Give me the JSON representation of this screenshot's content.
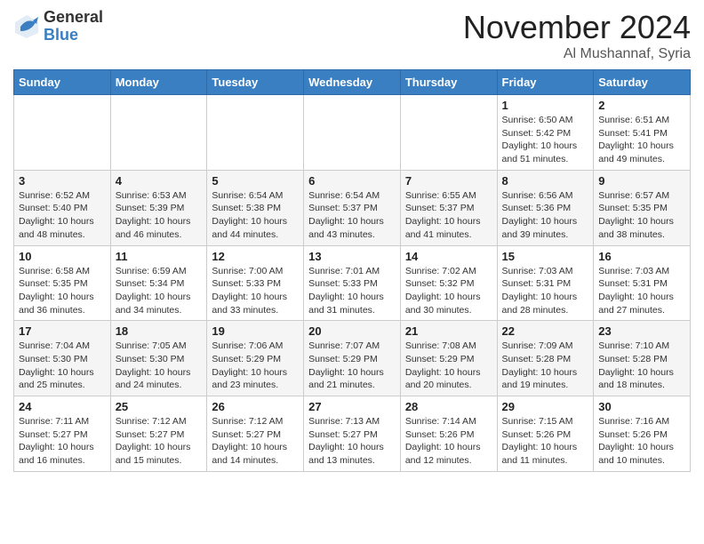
{
  "header": {
    "logo_general": "General",
    "logo_blue": "Blue",
    "month_title": "November 2024",
    "location": "Al Mushannaf, Syria"
  },
  "calendar": {
    "days_of_week": [
      "Sunday",
      "Monday",
      "Tuesday",
      "Wednesday",
      "Thursday",
      "Friday",
      "Saturday"
    ],
    "weeks": [
      [
        {
          "day": "",
          "info": ""
        },
        {
          "day": "",
          "info": ""
        },
        {
          "day": "",
          "info": ""
        },
        {
          "day": "",
          "info": ""
        },
        {
          "day": "",
          "info": ""
        },
        {
          "day": "1",
          "info": "Sunrise: 6:50 AM\nSunset: 5:42 PM\nDaylight: 10 hours\nand 51 minutes."
        },
        {
          "day": "2",
          "info": "Sunrise: 6:51 AM\nSunset: 5:41 PM\nDaylight: 10 hours\nand 49 minutes."
        }
      ],
      [
        {
          "day": "3",
          "info": "Sunrise: 6:52 AM\nSunset: 5:40 PM\nDaylight: 10 hours\nand 48 minutes."
        },
        {
          "day": "4",
          "info": "Sunrise: 6:53 AM\nSunset: 5:39 PM\nDaylight: 10 hours\nand 46 minutes."
        },
        {
          "day": "5",
          "info": "Sunrise: 6:54 AM\nSunset: 5:38 PM\nDaylight: 10 hours\nand 44 minutes."
        },
        {
          "day": "6",
          "info": "Sunrise: 6:54 AM\nSunset: 5:37 PM\nDaylight: 10 hours\nand 43 minutes."
        },
        {
          "day": "7",
          "info": "Sunrise: 6:55 AM\nSunset: 5:37 PM\nDaylight: 10 hours\nand 41 minutes."
        },
        {
          "day": "8",
          "info": "Sunrise: 6:56 AM\nSunset: 5:36 PM\nDaylight: 10 hours\nand 39 minutes."
        },
        {
          "day": "9",
          "info": "Sunrise: 6:57 AM\nSunset: 5:35 PM\nDaylight: 10 hours\nand 38 minutes."
        }
      ],
      [
        {
          "day": "10",
          "info": "Sunrise: 6:58 AM\nSunset: 5:35 PM\nDaylight: 10 hours\nand 36 minutes."
        },
        {
          "day": "11",
          "info": "Sunrise: 6:59 AM\nSunset: 5:34 PM\nDaylight: 10 hours\nand 34 minutes."
        },
        {
          "day": "12",
          "info": "Sunrise: 7:00 AM\nSunset: 5:33 PM\nDaylight: 10 hours\nand 33 minutes."
        },
        {
          "day": "13",
          "info": "Sunrise: 7:01 AM\nSunset: 5:33 PM\nDaylight: 10 hours\nand 31 minutes."
        },
        {
          "day": "14",
          "info": "Sunrise: 7:02 AM\nSunset: 5:32 PM\nDaylight: 10 hours\nand 30 minutes."
        },
        {
          "day": "15",
          "info": "Sunrise: 7:03 AM\nSunset: 5:31 PM\nDaylight: 10 hours\nand 28 minutes."
        },
        {
          "day": "16",
          "info": "Sunrise: 7:03 AM\nSunset: 5:31 PM\nDaylight: 10 hours\nand 27 minutes."
        }
      ],
      [
        {
          "day": "17",
          "info": "Sunrise: 7:04 AM\nSunset: 5:30 PM\nDaylight: 10 hours\nand 25 minutes."
        },
        {
          "day": "18",
          "info": "Sunrise: 7:05 AM\nSunset: 5:30 PM\nDaylight: 10 hours\nand 24 minutes."
        },
        {
          "day": "19",
          "info": "Sunrise: 7:06 AM\nSunset: 5:29 PM\nDaylight: 10 hours\nand 23 minutes."
        },
        {
          "day": "20",
          "info": "Sunrise: 7:07 AM\nSunset: 5:29 PM\nDaylight: 10 hours\nand 21 minutes."
        },
        {
          "day": "21",
          "info": "Sunrise: 7:08 AM\nSunset: 5:29 PM\nDaylight: 10 hours\nand 20 minutes."
        },
        {
          "day": "22",
          "info": "Sunrise: 7:09 AM\nSunset: 5:28 PM\nDaylight: 10 hours\nand 19 minutes."
        },
        {
          "day": "23",
          "info": "Sunrise: 7:10 AM\nSunset: 5:28 PM\nDaylight: 10 hours\nand 18 minutes."
        }
      ],
      [
        {
          "day": "24",
          "info": "Sunrise: 7:11 AM\nSunset: 5:27 PM\nDaylight: 10 hours\nand 16 minutes."
        },
        {
          "day": "25",
          "info": "Sunrise: 7:12 AM\nSunset: 5:27 PM\nDaylight: 10 hours\nand 15 minutes."
        },
        {
          "day": "26",
          "info": "Sunrise: 7:12 AM\nSunset: 5:27 PM\nDaylight: 10 hours\nand 14 minutes."
        },
        {
          "day": "27",
          "info": "Sunrise: 7:13 AM\nSunset: 5:27 PM\nDaylight: 10 hours\nand 13 minutes."
        },
        {
          "day": "28",
          "info": "Sunrise: 7:14 AM\nSunset: 5:26 PM\nDaylight: 10 hours\nand 12 minutes."
        },
        {
          "day": "29",
          "info": "Sunrise: 7:15 AM\nSunset: 5:26 PM\nDaylight: 10 hours\nand 11 minutes."
        },
        {
          "day": "30",
          "info": "Sunrise: 7:16 AM\nSunset: 5:26 PM\nDaylight: 10 hours\nand 10 minutes."
        }
      ]
    ]
  }
}
